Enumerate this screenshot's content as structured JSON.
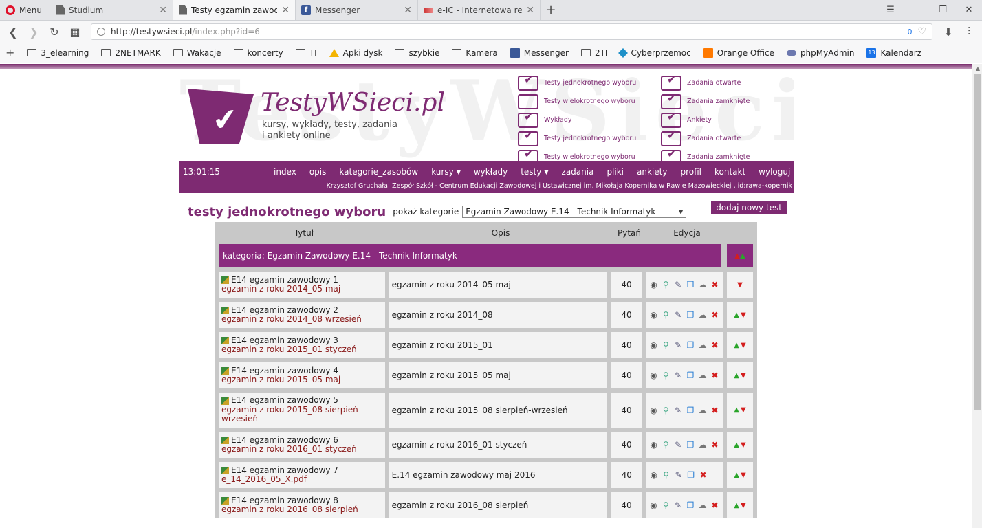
{
  "browser": {
    "menu_label": "Menu",
    "tabs": [
      {
        "title": "Studium",
        "icon": "document-icon"
      },
      {
        "title": "Testy egzamin zawodowy",
        "icon": "document-icon"
      },
      {
        "title": "Messenger",
        "icon": "facebook-icon"
      },
      {
        "title": "e-IC - Internetowa rezerwa",
        "icon": "eic-icon"
      }
    ],
    "url_host": "http://testywsieci.pl",
    "url_path": "/index.php?id=6",
    "url_badge": "0",
    "bookmarks": [
      "3_elearning",
      "2NETMARK",
      "Wakacje",
      "koncerty",
      "TI",
      "Apki dysk",
      "szybkie",
      "Kamera",
      "Messenger",
      "2TI",
      "Cyberprzemoc",
      "Orange Office",
      "phpMyAdmin",
      "Kalendarz"
    ],
    "calendar_day": "13"
  },
  "site": {
    "name": "TestyWSieci.pl",
    "tagline": "kursy, wykłady, testy, zadania i ankiety online",
    "watermark": "TestyWSieci",
    "header_categories_left": [
      "Testy jednokrotnego wyboru",
      "Testy wielokrotnego wyboru",
      "Wykłady",
      "Testy jednokrotnego wyboru",
      "Testy wielokrotnego wyboru"
    ],
    "header_categories_right": [
      "Zadania otwarte",
      "Zadania zamknięte",
      "Ankiety",
      "Zadania otwarte",
      "Zadania zamknięte"
    ]
  },
  "menubar": {
    "clock": "13:01:15",
    "items": [
      "index",
      "opis",
      "kategorie_zasobów",
      "kursy",
      "wykłady",
      "testy",
      "zadania",
      "pliki",
      "ankiety",
      "profil",
      "kontakt",
      "wyloguj"
    ],
    "user_info": "Krzysztof Gruchała: Zespół Szkół - Centrum Edukacji Zawodowej i Ustawicznej im. Mikołaja Kopernika w Rawie Mazowieckiej , id:rawa-kopernik"
  },
  "page": {
    "title": "testy jednokrotnego wyboru",
    "category_label": "pokaż kategorie",
    "category_selected": "Egzamin Zawodowy E.14 - Technik Informatyk",
    "add_button": "dodaj nowy test"
  },
  "table": {
    "headers": [
      "Tytuł",
      "Opis",
      "Pytań",
      "Edycja"
    ],
    "category_row": "kategoria: Egzamin Zawodowy E.14 - Technik Informatyk",
    "rows": [
      {
        "title": "E14 egzamin zawodowy 1",
        "sub": "egzamin z roku 2014_05 maj",
        "desc": "egzamin z roku 2014_05 maj",
        "count": "40"
      },
      {
        "title": "E14 egzamin zawodowy 2",
        "sub": "egzamin z roku 2014_08 wrzesień",
        "desc": "egzamin z roku 2014_08",
        "count": "40"
      },
      {
        "title": "E14 egzamin zawodowy 3",
        "sub": "egzamin z roku 2015_01 styczeń",
        "desc": "egzamin z roku 2015_01",
        "count": "40"
      },
      {
        "title": "E14 egzamin zawodowy 4",
        "sub": "egzamin z roku 2015_05 maj",
        "desc": "egzamin z roku 2015_05 maj",
        "count": "40"
      },
      {
        "title": "E14 egzamin zawodowy 5",
        "sub": "egzamin z roku 2015_08 sierpień-wrzesień",
        "desc": "egzamin z roku 2015_08 sierpień-wrzesień",
        "count": "40"
      },
      {
        "title": "E14 egzamin zawodowy 6",
        "sub": "egzamin z roku 2016_01 styczeń",
        "desc": "egzamin z roku 2016_01 styczeń",
        "count": "40"
      },
      {
        "title": "E14 egzamin zawodowy 7",
        "sub": "e_14_2016_05_X.pdf",
        "desc": "E.14 egzamin zawodowy maj 2016",
        "count": "40"
      },
      {
        "title": "E14 egzamin zawodowy 8",
        "sub": "egzamin z roku 2016_08 sierpień",
        "desc": "egzamin z roku 2016_08 sierpień",
        "count": "40"
      }
    ]
  },
  "colors": {
    "brand": "#7e2a72",
    "category_row": "#8a2a7e",
    "link_red": "#8a1a1a"
  }
}
